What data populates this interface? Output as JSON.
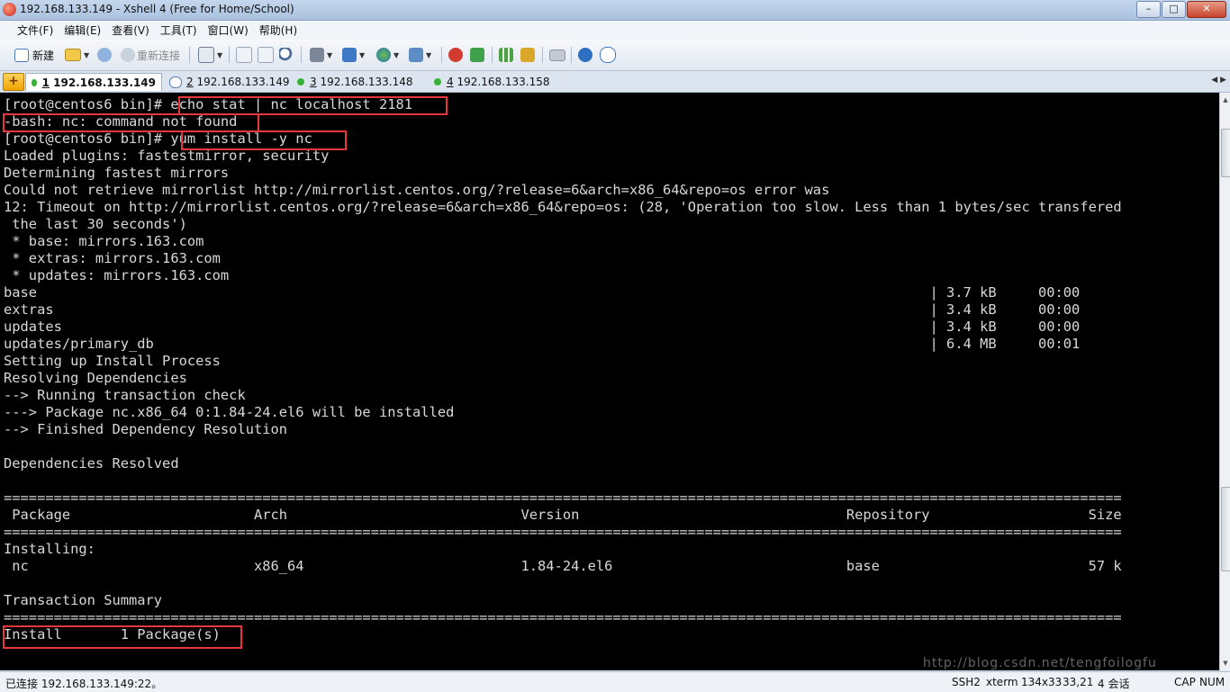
{
  "window": {
    "title": "192.168.133.149 - Xshell 4 (Free for Home/School)",
    "buttons": [
      "–",
      "□",
      "✕"
    ]
  },
  "menu": [
    "文件(F)",
    "编辑(E)",
    "查看(V)",
    "工具(T)",
    "窗口(W)",
    "帮助(H)"
  ],
  "toolbar": {
    "new_label": "新建",
    "reconnect_label": "重新连接"
  },
  "tabs": [
    {
      "num": "1",
      "host": "192.168.133.149",
      "active": true
    },
    {
      "num": "2",
      "host": "192.168.133.149",
      "active": false
    },
    {
      "num": "3",
      "host": "192.168.133.148",
      "active": false
    },
    {
      "num": "4",
      "host": "192.168.133.158",
      "active": false
    }
  ],
  "terminal": {
    "lines": [
      "[root@centos6 bin]# echo stat | nc localhost 2181",
      "-bash: nc: command not found",
      "[root@centos6 bin]# yum install -y nc",
      "Loaded plugins: fastestmirror, security",
      "Determining fastest mirrors",
      "Could not retrieve mirrorlist http://mirrorlist.centos.org/?release=6&arch=x86_64&repo=os error was",
      "12: Timeout on http://mirrorlist.centos.org/?release=6&arch=x86_64&repo=os: (28, 'Operation too slow. Less than 1 bytes/sec transfered",
      " the last 30 seconds')",
      " * base: mirrors.163.com",
      " * extras: mirrors.163.com",
      " * updates: mirrors.163.com",
      "base                                                                                                           | 3.7 kB     00:00",
      "extras                                                                                                         | 3.4 kB     00:00",
      "updates                                                                                                        | 3.4 kB     00:00",
      "updates/primary_db                                                                                             | 6.4 MB     00:01",
      "Setting up Install Process",
      "Resolving Dependencies",
      "--> Running transaction check",
      "---> Package nc.x86_64 0:1.84-24.el6 will be installed",
      "--> Finished Dependency Resolution",
      "",
      "Dependencies Resolved",
      "",
      "======================================================================================================================================",
      " Package                      Arch                            Version                                Repository                   Size",
      "======================================================================================================================================",
      "Installing:",
      " nc                           x86_64                          1.84-24.el6                            base                         57 k",
      "",
      "Transaction Summary",
      "======================================================================================================================================",
      "Install       1 Package(s)",
      ""
    ]
  },
  "status": {
    "connection": "已连接 192.168.133.149:22。",
    "protocol": "SSH2",
    "term": "xterm",
    "size": "134x33",
    "cursor": "33,21",
    "sessions": "4 会话",
    "cap": "CAP",
    "num": "NUM",
    "watermark": "http://blog.csdn.net/tengfoilogfu"
  }
}
